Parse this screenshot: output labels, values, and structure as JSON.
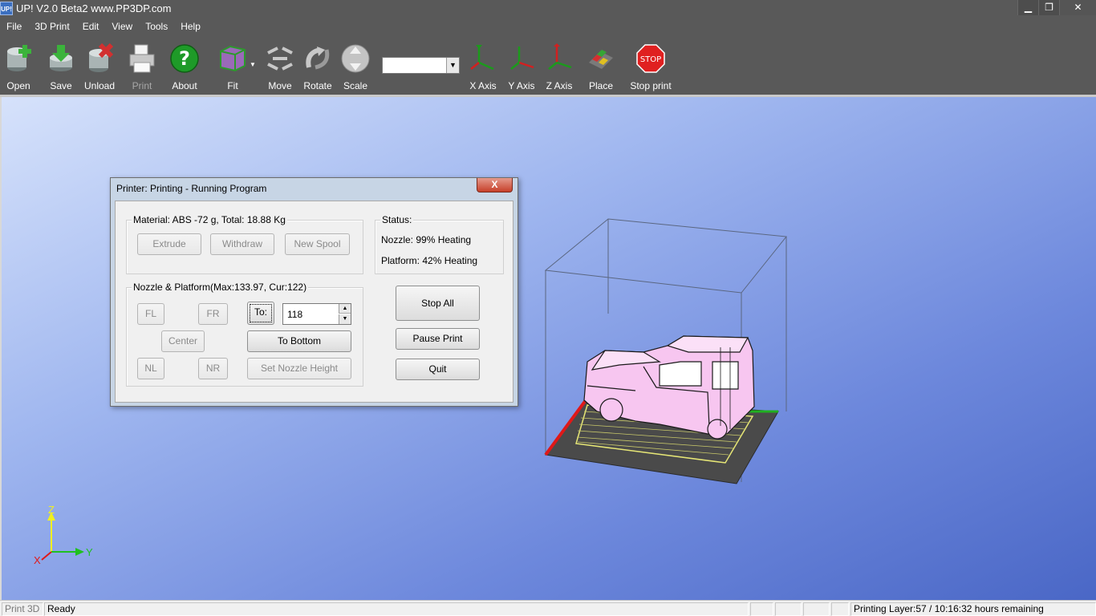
{
  "window": {
    "icon_text": "UP!",
    "title": "UP!  V2.0 Beta2 www.PP3DP.com",
    "minimize": "▁",
    "maximize": "❐",
    "close": "✕"
  },
  "menu": [
    "File",
    "3D Print",
    "Edit",
    "View",
    "Tools",
    "Help"
  ],
  "toolbar": {
    "open": "Open",
    "save": "Save",
    "unload": "Unload",
    "print": "Print",
    "about": "About",
    "fit": "Fit",
    "move": "Move",
    "rotate": "Rotate",
    "scale": "Scale",
    "combo_value": "",
    "x_axis": "X Axis",
    "y_axis": "Y Axis",
    "z_axis": "Z Axis",
    "place": "Place",
    "stop_print": "Stop print",
    "stop_sign_text": "STOP"
  },
  "axes_indicator": {
    "z": "Z",
    "y": "Y",
    "x": "X"
  },
  "dialog": {
    "title": "Printer: Printing - Running Program",
    "close": "X",
    "material": {
      "label": "Material: ABS -72 g,  Total: 18.88 Kg",
      "extrude": "Extrude",
      "withdraw": "Withdraw",
      "new_spool": "New Spool"
    },
    "status": {
      "label": "Status:",
      "nozzle": "Nozzle: 99%  Heating",
      "platform": "Platform: 42%  Heating"
    },
    "nozzle_platform": {
      "label": "Nozzle & Platform(Max:133.97, Cur:122)",
      "fl": "FL",
      "fr": "FR",
      "center": "Center",
      "nl": "NL",
      "nr": "NR",
      "to": "To:",
      "to_value": "118",
      "to_bottom": "To Bottom",
      "set_nozzle_height": "Set Nozzle Height"
    },
    "stop_all": "Stop All",
    "pause_print": "Pause Print",
    "quit": "Quit"
  },
  "statusbar": {
    "mode": "Print 3D",
    "state": "Ready",
    "progress": "Printing Layer:57 / 10:16:32 hours remaining"
  },
  "colors": {
    "chrome": "#595959",
    "viewport_top": "#d6e2fb",
    "viewport_bottom": "#4a67c6",
    "model": "#f7c6f0",
    "stop_red": "#e02020"
  }
}
